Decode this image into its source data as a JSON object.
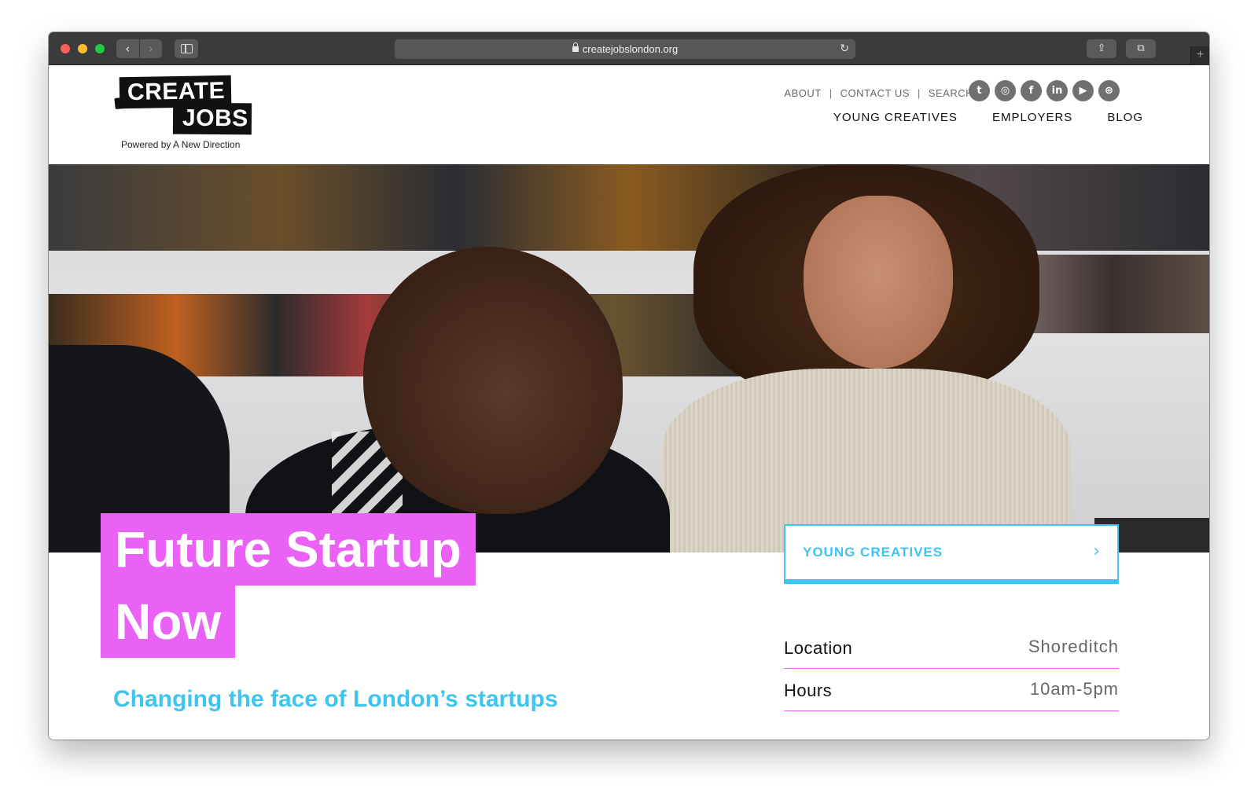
{
  "browser": {
    "url": "createjobslondon.org",
    "back_icon": "‹",
    "forward_icon": "›",
    "reload_icon": "↻",
    "share_icon": "⇪",
    "tabs_icon": "⧉",
    "new_tab_icon": "+"
  },
  "logo": {
    "line1": "CREATE",
    "line2": "JOBS",
    "subtitle": "Powered by A New Direction"
  },
  "top_links": [
    "ABOUT",
    "CONTACT US",
    "SEARCH"
  ],
  "top_links_separator": "|",
  "social_icons": [
    {
      "name": "twitter",
      "glyph": "t"
    },
    {
      "name": "instagram",
      "glyph": "◎"
    },
    {
      "name": "facebook",
      "glyph": "f"
    },
    {
      "name": "linkedin",
      "glyph": "in"
    },
    {
      "name": "youtube",
      "glyph": "▶"
    },
    {
      "name": "web",
      "glyph": "⊕"
    }
  ],
  "main_nav": [
    "YOUNG CREATIVES",
    "EMPLOYERS",
    "BLOG"
  ],
  "hero": {
    "title_line1": "Future Startup",
    "title_line2": "Now",
    "tagline": "Changing the face of London’s startups",
    "cta_label": "YOUNG CREATIVES",
    "cta_icon": "›"
  },
  "info": [
    {
      "label": "Location",
      "value": "Shoreditch"
    },
    {
      "label": "Hours",
      "value": "10am-5pm"
    }
  ],
  "colors": {
    "accent_pink": "#e961f5",
    "accent_blue": "#3fc4f0"
  }
}
